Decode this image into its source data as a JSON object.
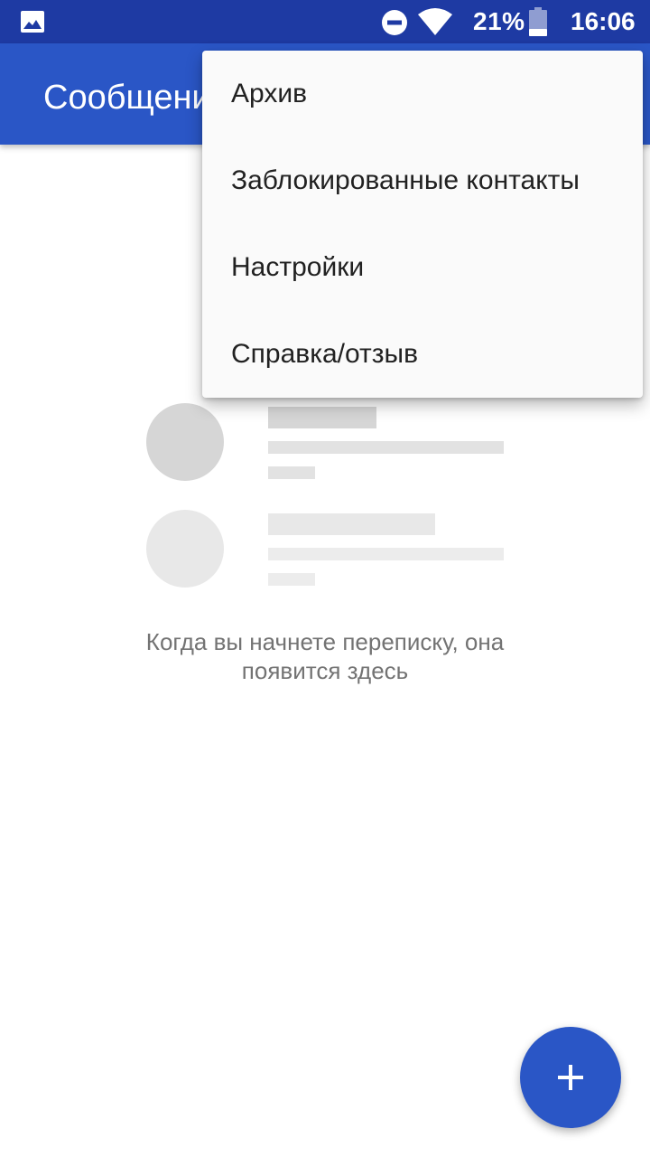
{
  "status_bar": {
    "battery_percent": "21%",
    "time": "16:06",
    "icons": [
      "gallery-icon",
      "do-not-disturb-icon",
      "wifi-icon",
      "battery-icon"
    ]
  },
  "app_bar": {
    "title": "Сообщения"
  },
  "menu": {
    "items": [
      {
        "label": "Архив"
      },
      {
        "label": "Заблокированные контакты"
      },
      {
        "label": "Настройки"
      },
      {
        "label": "Справка/отзыв"
      }
    ]
  },
  "empty_state": {
    "message": "Когда вы начнете переписку, она появится здесь"
  },
  "fab": {
    "icon": "plus-icon"
  },
  "colors": {
    "status_bar": "#1e3aa3",
    "primary": "#2a56c6",
    "menu_bg": "#fafafa",
    "placeholder_dark": "#d6d6d6",
    "placeholder_light": "#e8e8e8",
    "secondary_text": "#737373"
  }
}
